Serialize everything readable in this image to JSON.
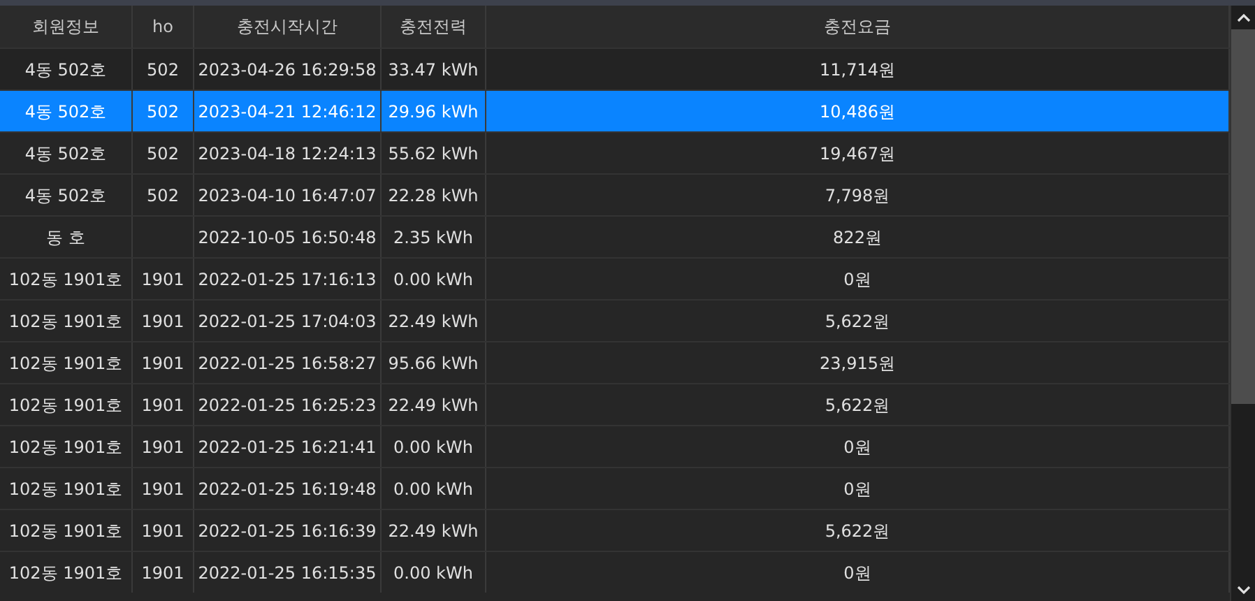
{
  "table": {
    "columns": [
      "회원정보",
      "ho",
      "충전시작시간",
      "충전전력",
      "충전요금"
    ],
    "rows": [
      {
        "cells": [
          "4동 502호",
          "502",
          "2023-04-26 16:29:58",
          "33.47 kWh",
          "11,714원"
        ],
        "selected": false
      },
      {
        "cells": [
          "4동 502호",
          "502",
          "2023-04-21 12:46:12",
          "29.96 kWh",
          "10,486원"
        ],
        "selected": true
      },
      {
        "cells": [
          "4동 502호",
          "502",
          "2023-04-18 12:24:13",
          "55.62 kWh",
          "19,467원"
        ],
        "selected": false
      },
      {
        "cells": [
          "4동 502호",
          "502",
          "2023-04-10 16:47:07",
          "22.28 kWh",
          "7,798원"
        ],
        "selected": false
      },
      {
        "cells": [
          "동 호",
          "",
          "2022-10-05 16:50:48",
          "2.35 kWh",
          "822원"
        ],
        "selected": false
      },
      {
        "cells": [
          "102동 1901호",
          "1901",
          "2022-01-25 17:16:13",
          "0.00 kWh",
          "0원"
        ],
        "selected": false
      },
      {
        "cells": [
          "102동 1901호",
          "1901",
          "2022-01-25 17:04:03",
          "22.49 kWh",
          "5,622원"
        ],
        "selected": false
      },
      {
        "cells": [
          "102동 1901호",
          "1901",
          "2022-01-25 16:58:27",
          "95.66 kWh",
          "23,915원"
        ],
        "selected": false
      },
      {
        "cells": [
          "102동 1901호",
          "1901",
          "2022-01-25 16:25:23",
          "22.49 kWh",
          "5,622원"
        ],
        "selected": false
      },
      {
        "cells": [
          "102동 1901호",
          "1901",
          "2022-01-25 16:21:41",
          "0.00 kWh",
          "0원"
        ],
        "selected": false
      },
      {
        "cells": [
          "102동 1901호",
          "1901",
          "2022-01-25 16:19:48",
          "0.00 kWh",
          "0원"
        ],
        "selected": false
      },
      {
        "cells": [
          "102동 1901호",
          "1901",
          "2022-01-25 16:16:39",
          "22.49 kWh",
          "5,622원"
        ],
        "selected": false
      },
      {
        "cells": [
          "102동 1901호",
          "1901",
          "2022-01-25 16:15:35",
          "0.00 kWh",
          "0원"
        ],
        "selected": false
      }
    ]
  }
}
